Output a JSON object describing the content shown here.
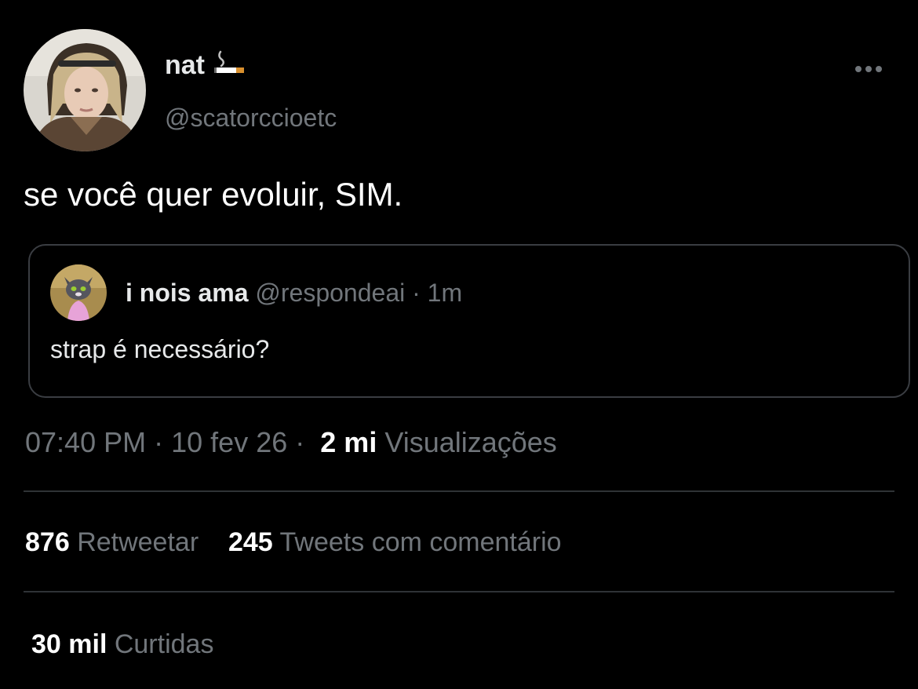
{
  "author": {
    "name": "nat",
    "handle": "@scatorccioetc",
    "name_icon": "cigarette-icon"
  },
  "tweet": {
    "text": "se você quer evoluir, SIM."
  },
  "quote": {
    "name": "i nois ama",
    "handle": "@respondeai",
    "separator": "·",
    "time": "1m",
    "text": "strap é necessário?"
  },
  "meta": {
    "time": "07:40 PM",
    "separator": "·",
    "date": "10 fev 26",
    "views_count": "2 mi",
    "views_label": "Visualizações"
  },
  "stats": {
    "retweets_count": "876",
    "retweets_label": "Retweetar",
    "quotes_count": "245",
    "quotes_label": "Tweets com comentário",
    "likes_count": "30 mil",
    "likes_label": "Curtidas"
  },
  "colors": {
    "background": "#000000",
    "primary_text": "#e7e9ea",
    "secondary_text": "#71767b",
    "border": "#2f3336"
  }
}
